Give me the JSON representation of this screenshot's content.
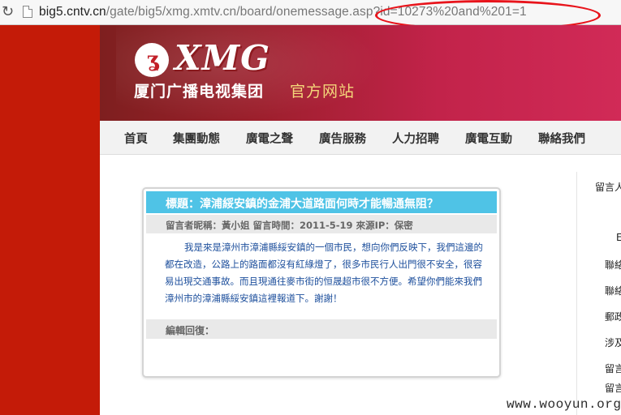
{
  "browser": {
    "url_host": "big5.cntv.cn",
    "url_path": "/gate/big5/xmg.xmtv.cn/board/onemessage.asp?id=10273%20and%201=1"
  },
  "banner": {
    "logo_text": "XMG",
    "group_name": "厦门广播电视集团",
    "official_site": "官方网站"
  },
  "nav": {
    "items": [
      "首頁",
      "集團動態",
      "廣電之聲",
      "廣告服務",
      "人力招聘",
      "廣電互動",
      "聯絡我們"
    ]
  },
  "message": {
    "title": "標題：漳浦綏安鎮的金浦大道路面何時才能暢通無阻？",
    "meta": "留言者昵稱：黃小姐  留言時間：2011-5-19  來源IP：保密",
    "body": "我是來是漳州市漳浦縣綏安鎮的一個市民，想向你們反映下，我們這邊的都在改造，公路上的路面都沒有紅綠燈了，很多市民行人出門很不安全，很容易出現交通事故。而且現通往麥市街的恒晟超市很不方便。希望你們能來我們漳州市的漳浦縣綏安鎮這裡報道下。謝謝！",
    "reply_label": "編輯回復："
  },
  "sidebar": {
    "items": [
      "留言人",
      "E",
      "聯絡",
      "聯絡",
      "郵政",
      "涉及",
      "留言",
      "留言"
    ]
  },
  "watermark": "www.wooyun.org",
  "colors": {
    "accent_red": "#c41b08",
    "title_blue": "#4fc3e6",
    "body_text_blue": "#1d4f9c",
    "annotation_red": "#e8141b"
  }
}
